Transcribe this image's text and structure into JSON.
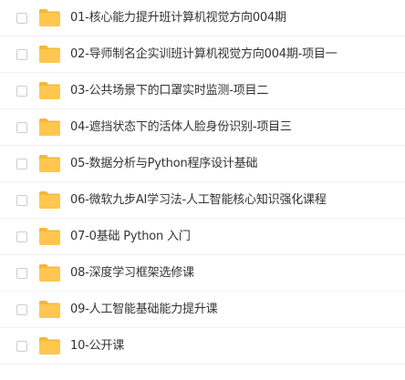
{
  "folder_color": "#ffc74f",
  "folder_tab_color": "#f5b63a",
  "items": [
    {
      "label": "01-核心能力提升班计算机视觉方向004期",
      "icon": "folder-icon"
    },
    {
      "label": "02-导师制名企实训班计算机视觉方向004期-项目一",
      "icon": "folder-icon"
    },
    {
      "label": "03-公共场景下的口罩实时监测-项目二",
      "icon": "folder-icon"
    },
    {
      "label": "04-遮挡状态下的活体人脸身份识别-项目三",
      "icon": "folder-icon"
    },
    {
      "label": "05-数据分析与Python程序设计基础",
      "icon": "folder-icon"
    },
    {
      "label": "06-微软九步AI学习法-人工智能核心知识强化课程",
      "icon": "folder-icon"
    },
    {
      "label": "07-0基础 Python 入门",
      "icon": "folder-icon"
    },
    {
      "label": "08-深度学习框架选修课",
      "icon": "folder-icon"
    },
    {
      "label": "09-人工智能基础能力提升课",
      "icon": "folder-icon"
    },
    {
      "label": "10-公开课",
      "icon": "folder-icon"
    }
  ]
}
